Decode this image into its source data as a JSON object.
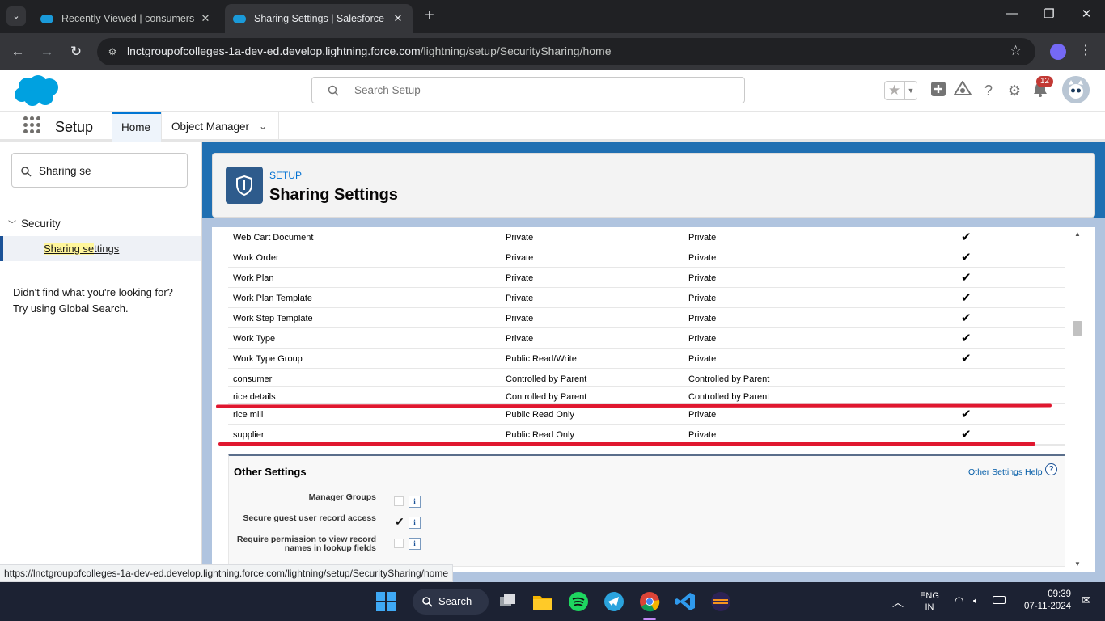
{
  "browser": {
    "tabs": [
      {
        "title": "Recently Viewed | consumers | S",
        "active": false
      },
      {
        "title": "Sharing Settings | Salesforce",
        "active": true
      }
    ],
    "url_host": "lnctgroupofcolleges-1a-dev-ed.develop.lightning.force.com",
    "url_path": "/lightning/setup/SecuritySharing/home",
    "status_url": "https://lnctgroupofcolleges-1a-dev-ed.develop.lightning.force.com/lightning/setup/SecuritySharing/home"
  },
  "header": {
    "search_placeholder": "Search Setup",
    "notification_count": "12"
  },
  "nav": {
    "app_name": "Setup",
    "tabs": [
      {
        "label": "Home",
        "active": true
      },
      {
        "label": "Object Manager",
        "active": false
      }
    ]
  },
  "sidebar": {
    "quick_find_value": "Sharing se",
    "section": "Security",
    "item_label": "Sharing Settings",
    "item_highlight": "Sharing se",
    "item_rest": "ttings",
    "not_found_line1": "Didn't find what you're looking for?",
    "not_found_line2": "Try using Global Search."
  },
  "page_header": {
    "eyebrow": "SETUP",
    "title": "Sharing Settings"
  },
  "defaults_table": {
    "rows": [
      {
        "object": "Web Cart Document",
        "internal": "Private",
        "external": "Private",
        "hierarchy": "✔"
      },
      {
        "object": "Work Order",
        "internal": "Private",
        "external": "Private",
        "hierarchy": "✔"
      },
      {
        "object": "Work Plan",
        "internal": "Private",
        "external": "Private",
        "hierarchy": "✔"
      },
      {
        "object": "Work Plan Template",
        "internal": "Private",
        "external": "Private",
        "hierarchy": "✔"
      },
      {
        "object": "Work Step Template",
        "internal": "Private",
        "external": "Private",
        "hierarchy": "✔"
      },
      {
        "object": "Work Type",
        "internal": "Private",
        "external": "Private",
        "hierarchy": "✔"
      },
      {
        "object": "Work Type Group",
        "internal": "Public Read/Write",
        "external": "Private",
        "hierarchy": "✔"
      },
      {
        "object": "consumer",
        "internal": "Controlled by Parent",
        "external": "Controlled by Parent",
        "hierarchy": ""
      },
      {
        "object": "rice details",
        "internal": "Controlled by Parent",
        "external": "Controlled by Parent",
        "hierarchy": ""
      },
      {
        "object": "rice mill",
        "internal": "Public Read Only",
        "external": "Private",
        "hierarchy": "✔"
      },
      {
        "object": "supplier",
        "internal": "Public Read Only",
        "external": "Private",
        "hierarchy": "✔"
      }
    ]
  },
  "other_settings": {
    "title": "Other Settings",
    "help_link": "Other Settings Help",
    "items": [
      {
        "label_line1": "Manager Groups",
        "label_line2": "",
        "checked": false
      },
      {
        "label_line1": "Secure guest user record access",
        "label_line2": "",
        "checked": true
      },
      {
        "label_line1": "Require permission to view record",
        "label_line2": "names in lookup fields",
        "checked": false
      }
    ]
  },
  "taskbar": {
    "search_label": "Search",
    "lang_line1": "ENG",
    "lang_line2": "IN",
    "time": "09:39",
    "date": "07-11-2024"
  },
  "colors": {
    "brand_blue": "#0176d3",
    "annotation_red": "#e0172f",
    "header_icon_bg": "#2e5b8c"
  }
}
